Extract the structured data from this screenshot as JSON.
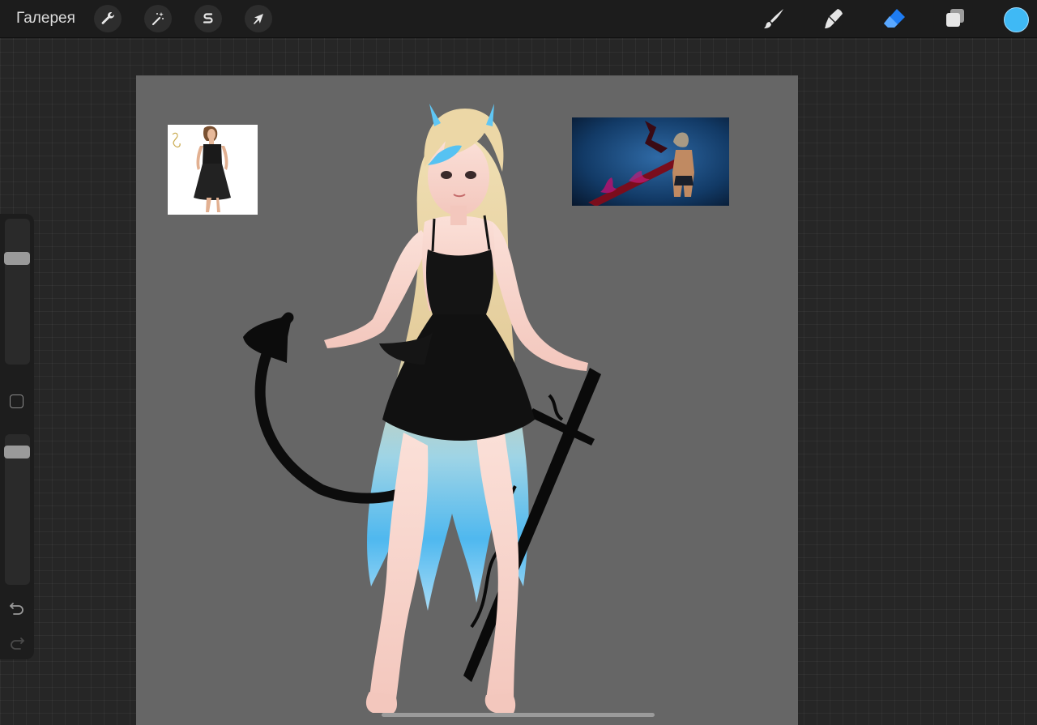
{
  "topbar": {
    "gallery_label": "Галерея",
    "left_tools": [
      {
        "name": "actions",
        "icon": "wrench-icon"
      },
      {
        "name": "adjustments",
        "icon": "magic-wand-icon"
      },
      {
        "name": "selection",
        "icon": "selection-s-icon"
      },
      {
        "name": "transform",
        "icon": "arrow-cursor-icon"
      }
    ],
    "right_tools": [
      {
        "name": "brush",
        "icon": "brush-icon",
        "active": false
      },
      {
        "name": "smudge",
        "icon": "smudge-icon",
        "active": false
      },
      {
        "name": "eraser",
        "icon": "eraser-icon",
        "active": true
      },
      {
        "name": "layers",
        "icon": "layers-icon",
        "active": false
      }
    ],
    "current_color": "#3fb9f5"
  },
  "sidebar": {
    "brush_size_level": 0.75,
    "opacity_level": 0.92,
    "buttons": [
      {
        "name": "modify",
        "icon": "square-icon"
      },
      {
        "name": "undo",
        "icon": "undo-icon"
      },
      {
        "name": "redo",
        "icon": "redo-icon",
        "enabled": false
      }
    ]
  },
  "canvas": {
    "background": "#666666",
    "references": [
      {
        "name": "black-dress-reference",
        "icon": "photo-reference"
      },
      {
        "name": "anime-swordsman-reference",
        "icon": "photo-reference"
      }
    ],
    "artwork": "anime-demon-girl-drawing"
  },
  "colors": {
    "accent": "#1e7cf2",
    "hair_blue": "#4fc3f7",
    "hair_blonde": "#e6d3a3"
  }
}
